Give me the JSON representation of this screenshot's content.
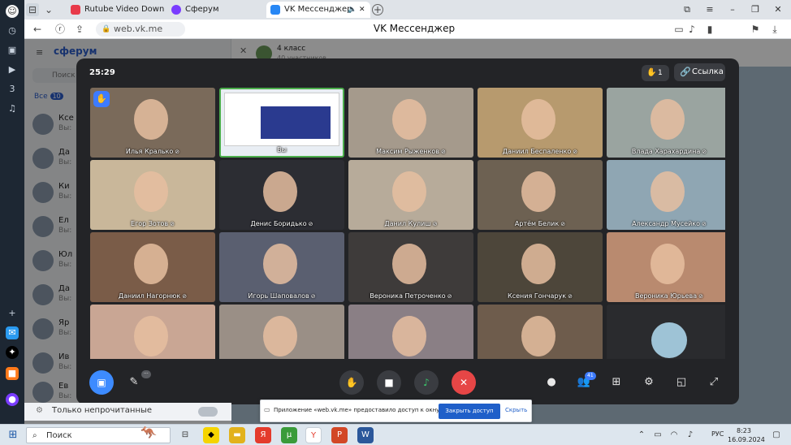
{
  "browser": {
    "tabs": [
      {
        "label": "Rutube Video Downloader",
        "icon_color": "#e83a4a"
      },
      {
        "label": "Сферум",
        "icon_color": "#7a3cff"
      },
      {
        "label": "VK Мессенджер",
        "icon_color": "#2787f5",
        "active": true
      }
    ],
    "url": "web.vk.me",
    "page_title": "VK Мессенджер"
  },
  "vk": {
    "brand": "сферум",
    "search_placeholder": "Поиск",
    "filter_label": "Все",
    "filter_count": "10",
    "chat_header_title": "4 класс",
    "chat_header_sub": "40 участников",
    "chats": [
      {
        "name": "Ксе",
        "snippet": "Вы:"
      },
      {
        "name": "Да",
        "snippet": "Вы:"
      },
      {
        "name": "Ки",
        "snippet": "Вы:"
      },
      {
        "name": "Ел",
        "snippet": "Вы:"
      },
      {
        "name": "Юл",
        "snippet": "Вы:"
      },
      {
        "name": "Да",
        "snippet": "Вы:"
      },
      {
        "name": "Яр",
        "snippet": "Вы:"
      },
      {
        "name": "Ив",
        "snippet": "Вы:"
      },
      {
        "name": "Ев",
        "snippet": "Вы:"
      }
    ],
    "unread_only_label": "Только непрочитанные"
  },
  "call": {
    "timer": "25:29",
    "raised_hands": "1",
    "link_label": "Ссылка",
    "participants_count": "41",
    "participants": [
      {
        "name": "Илья Кралько",
        "bg": "#7a6a5a",
        "hand": true
      },
      {
        "name": "Вы",
        "bg": "#e9eef4",
        "me": true
      },
      {
        "name": "Максим Рыженков",
        "bg": "#a59a8c"
      },
      {
        "name": "Даниил Беспаленко",
        "bg": "#b79a6e"
      },
      {
        "name": "Влада Харахардина",
        "bg": "#9aa4a0"
      },
      {
        "name": "Егор Зотов",
        "bg": "#c9b79a"
      },
      {
        "name": "Денис Боридько",
        "bg": "#2c2d33"
      },
      {
        "name": "Данил Кулиш",
        "bg": "#b7ab9a"
      },
      {
        "name": "Артём Белик",
        "bg": "#6d6152"
      },
      {
        "name": "Александр Мусейко",
        "bg": "#8fa6b3"
      },
      {
        "name": "Даниил Нагорнюк",
        "bg": "#7a5c48"
      },
      {
        "name": "Игорь Шаповалов",
        "bg": "#5a5f70"
      },
      {
        "name": "Вероника Петроченко",
        "bg": "#3e3b3a"
      },
      {
        "name": "Ксения Гончарук",
        "bg": "#4d463a"
      },
      {
        "name": "Вероника Юрьева",
        "bg": "#b98a6f"
      },
      {
        "name": "",
        "bg": "#c9a694"
      },
      {
        "name": "",
        "bg": "#9a8f86"
      },
      {
        "name": "",
        "bg": "#8a7f85"
      },
      {
        "name": "",
        "bg": "#6e5c4c"
      },
      {
        "name": "",
        "bg": "#2a2b2e",
        "avatar": true
      }
    ]
  },
  "notification": {
    "text": "Приложение «web.vk.me» предоставило доступ к окну.",
    "allow_label": "Закрыть доступ",
    "hide_label": "Скрыть"
  },
  "taskbar": {
    "search_label": "Поиск",
    "language": "РУС",
    "time": "8:23",
    "date": "16.09.2024"
  }
}
